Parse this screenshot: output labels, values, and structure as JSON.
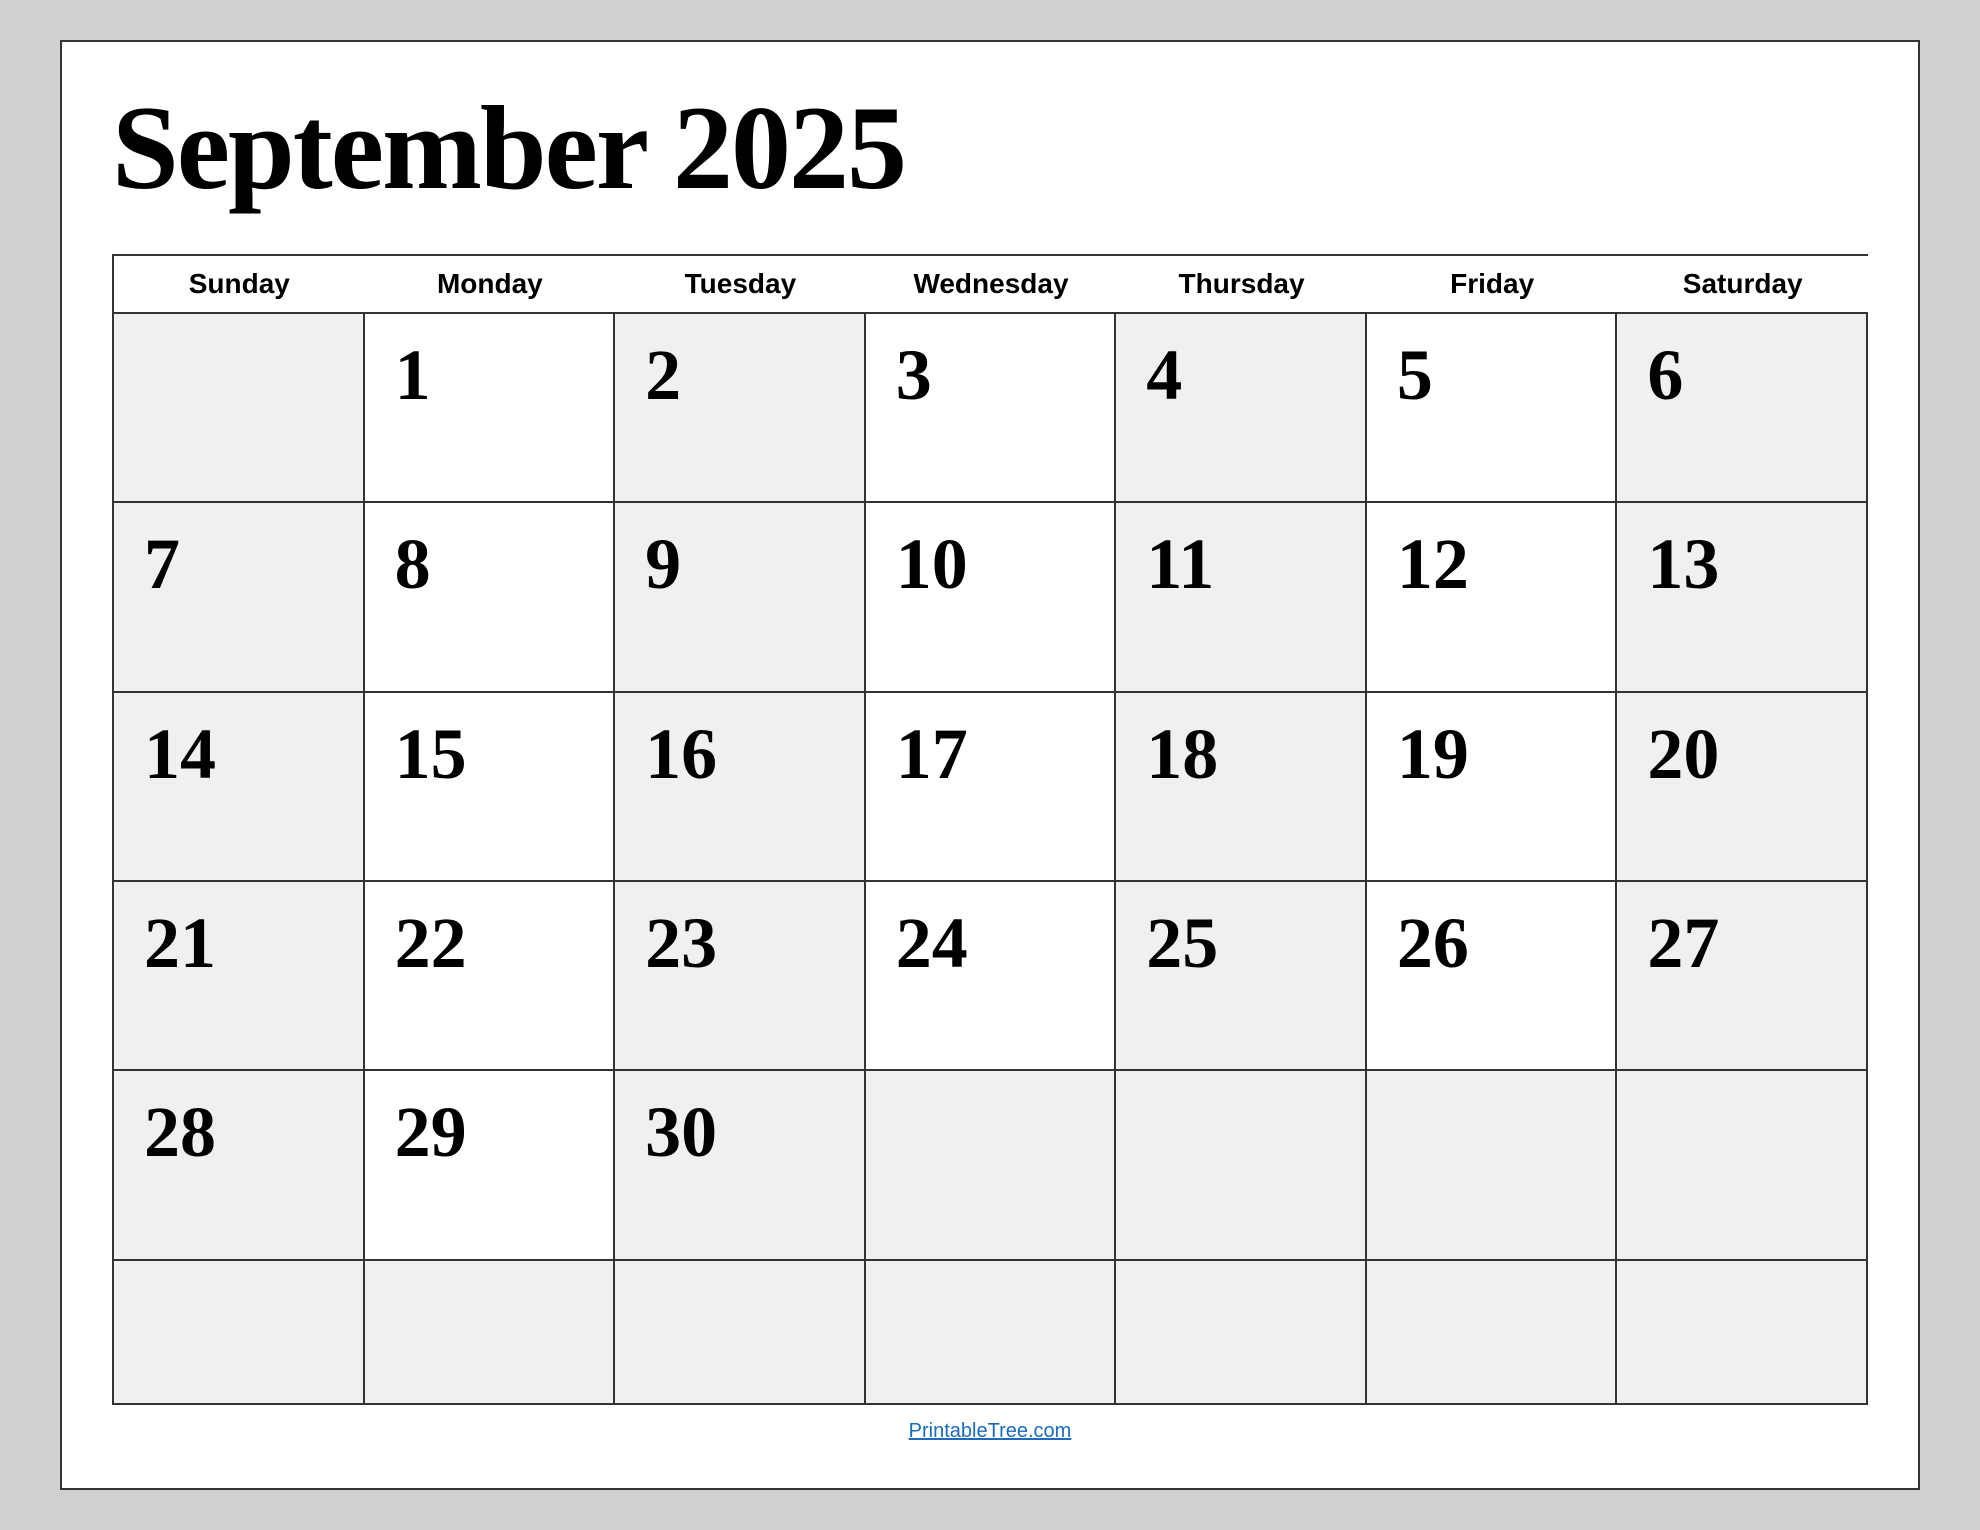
{
  "title": "September 2025",
  "days_of_week": [
    "Sunday",
    "Monday",
    "Tuesday",
    "Wednesday",
    "Thursday",
    "Friday",
    "Saturday"
  ],
  "weeks": [
    [
      "",
      "1",
      "2",
      "3",
      "4",
      "5",
      "6"
    ],
    [
      "7",
      "8",
      "9",
      "10",
      "11",
      "12",
      "13"
    ],
    [
      "14",
      "15",
      "16",
      "17",
      "18",
      "19",
      "20"
    ],
    [
      "21",
      "22",
      "23",
      "24",
      "25",
      "26",
      "27"
    ],
    [
      "28",
      "29",
      "30",
      "",
      "",
      "",
      ""
    ],
    [
      "",
      "",
      "",
      "",
      "",
      "",
      ""
    ]
  ],
  "footer_link_text": "PrintableTree.com",
  "footer_link_url": "https://PrintableTree.com"
}
